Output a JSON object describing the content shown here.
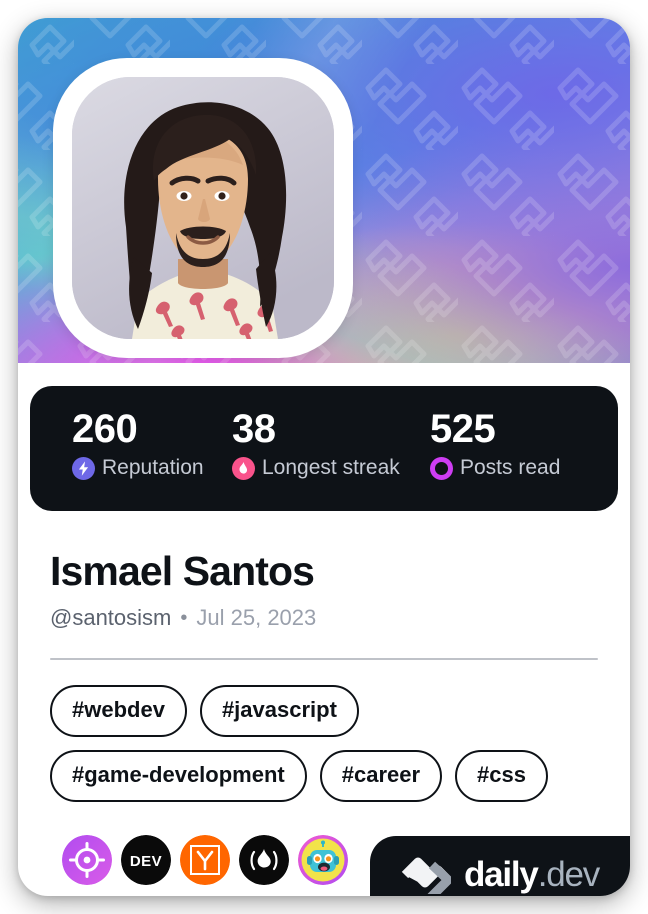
{
  "card": {
    "type": "devcard",
    "theme_colors": {
      "dark": "#0e1217",
      "text": "#0e1217",
      "muted": "#9aa0ac",
      "reputation": "#6e68e7",
      "streak": "#f9538b",
      "posts_read": "#ce3df3",
      "divider": "#bfc2c8"
    }
  },
  "header": {
    "avatar_alt": "Profile photo of Ismael Santos",
    "watermark_icon": "daily-dev-logo-pattern"
  },
  "stats": [
    {
      "value": "260",
      "label": "Reputation",
      "icon": "bolt-icon",
      "color": "#6e68e7"
    },
    {
      "value": "38",
      "label": "Longest streak",
      "icon": "flame-icon",
      "color": "#f9538b"
    },
    {
      "value": "525",
      "label": "Posts read",
      "icon": "ring-icon",
      "color": "#ce3df3"
    }
  ],
  "profile": {
    "name": "Ismael Santos",
    "handle": "@santosism",
    "separator": "•",
    "joined_date": "Jul 25, 2023"
  },
  "tags": [
    "#webdev",
    "#javascript",
    "#game-development",
    "#career",
    "#css"
  ],
  "badges": [
    {
      "name": "target-badge",
      "label": "Target"
    },
    {
      "name": "dev-badge",
      "label": "DEV"
    },
    {
      "name": "ycombinator-badge",
      "label": "Y"
    },
    {
      "name": "flame-badge",
      "label": "Flame"
    },
    {
      "name": "robot-badge",
      "label": "Robot"
    }
  ],
  "footer": {
    "logo_icon": "daily-dev-logo",
    "brand_primary": "daily",
    "brand_secondary": ".dev"
  }
}
